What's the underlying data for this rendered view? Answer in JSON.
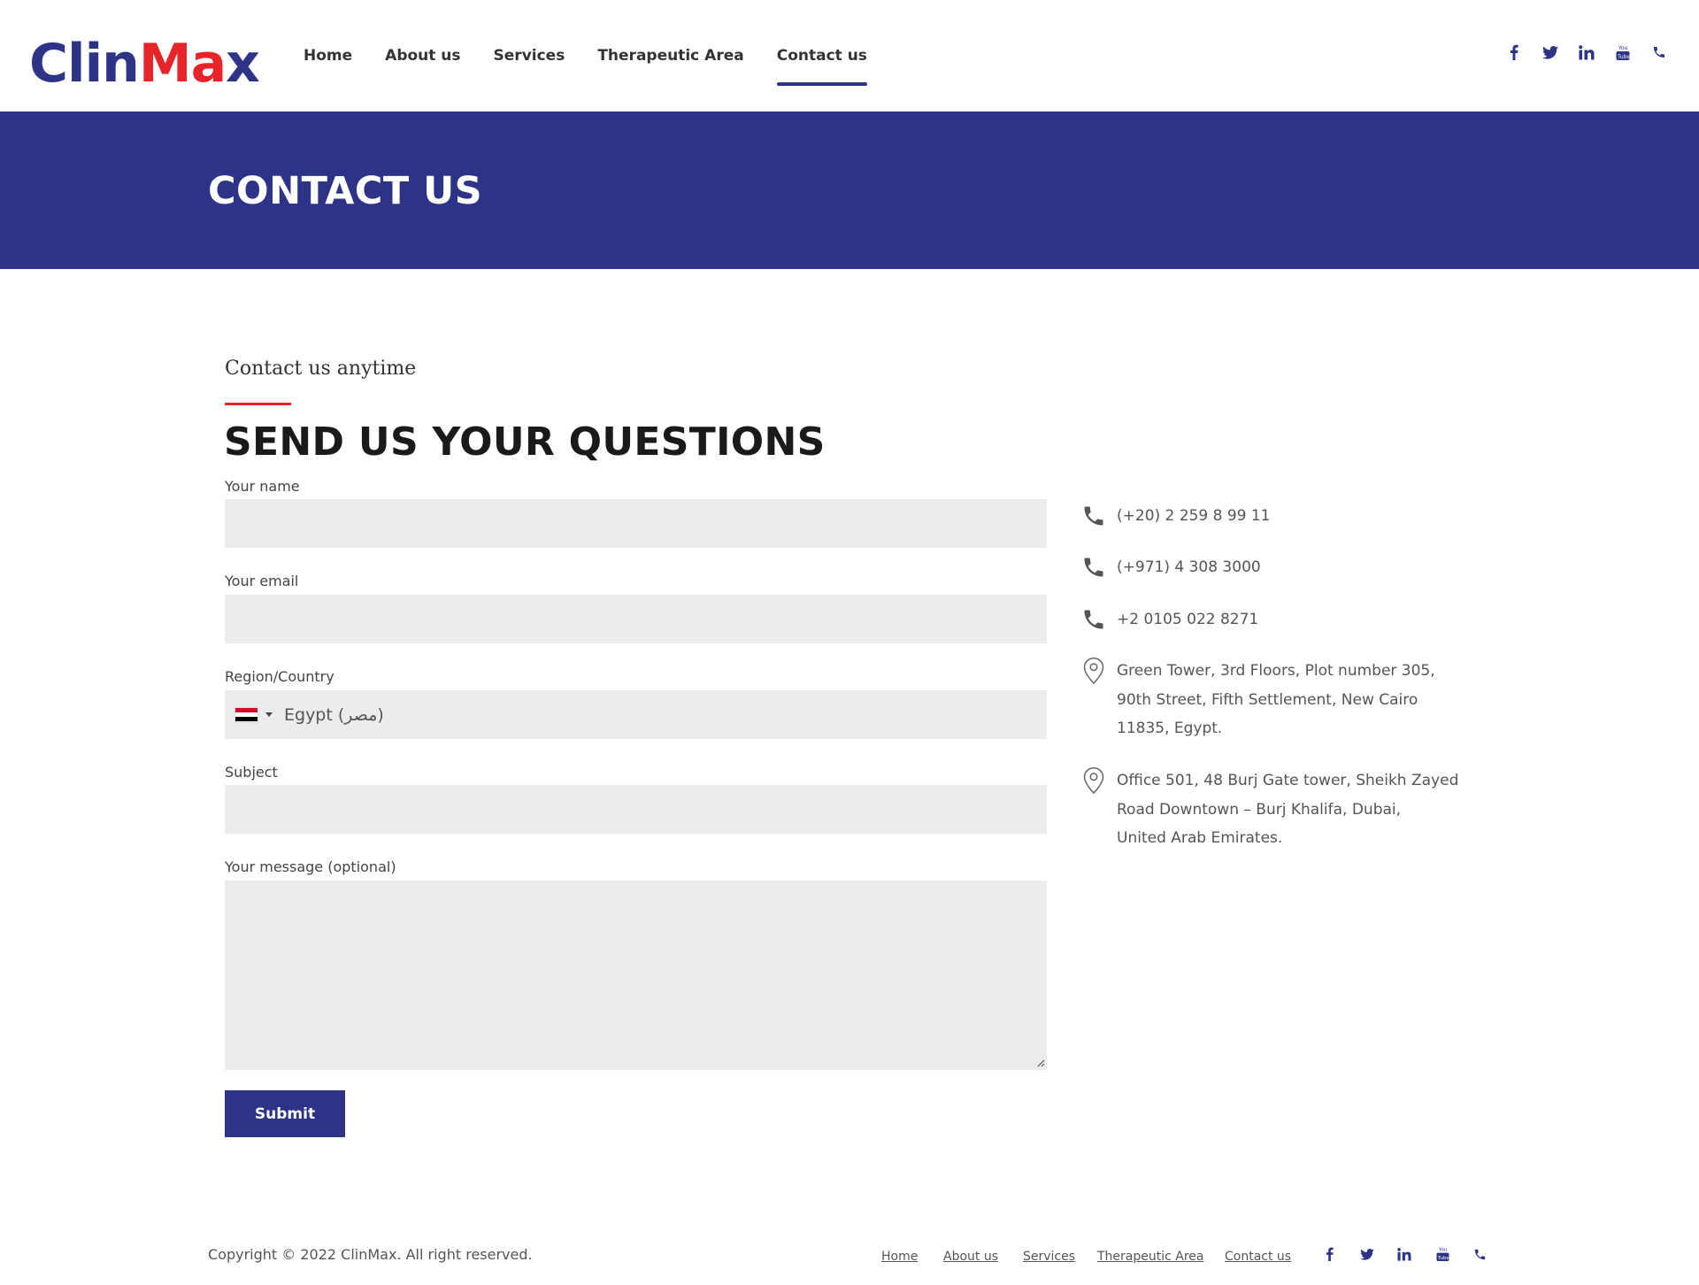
{
  "brand": {
    "logo_part1": "Clin",
    "logo_part2": "Ma",
    "logo_part3": "x",
    "primary_color": "#2d3387",
    "accent_color": "#e8242b"
  },
  "nav": {
    "items": [
      {
        "label": "Home",
        "active": false
      },
      {
        "label": "About us",
        "active": false
      },
      {
        "label": "Services",
        "active": false
      },
      {
        "label": "Therapeutic Area",
        "active": false
      },
      {
        "label": "Contact us",
        "active": true
      }
    ]
  },
  "social_icons": [
    "facebook-icon",
    "twitter-icon",
    "linkedin-icon",
    "youtube-icon",
    "phone-icon"
  ],
  "banner": {
    "title": "CONTACT US"
  },
  "form": {
    "eyebrow": "Contact us anytime",
    "title": "SEND US YOUR QUESTIONS",
    "name_label": "Your name",
    "name_value": "",
    "email_label": "Your email",
    "email_value": "",
    "country_label": "Region/Country",
    "country_value": "Egypt (‫مصر‬‎)",
    "subject_label": "Subject",
    "subject_value": "",
    "message_label": "Your message (optional)",
    "message_value": "",
    "submit_label": "Submit"
  },
  "contact": {
    "phones": [
      "(+20) 2 259 8 99 11",
      "(+971) 4 308 3000",
      "+2 0105 022 8271"
    ],
    "addresses": [
      [
        "Green Tower, 3rd Floors, Plot number 305,",
        "90th Street, Fifth Settlement, New Cairo",
        "11835, Egypt."
      ],
      [
        "Office 501, 48 Burj Gate tower, Sheikh Zayed",
        "Road Downtown – Burj Khalifa, Dubai,",
        "United Arab Emirates."
      ]
    ]
  },
  "footer": {
    "copyright": "Copyright © 2022 ClinMax. All right reserved.",
    "links": [
      "Home",
      "About us",
      "Services",
      "Therapeutic Area",
      "Contact us"
    ]
  }
}
